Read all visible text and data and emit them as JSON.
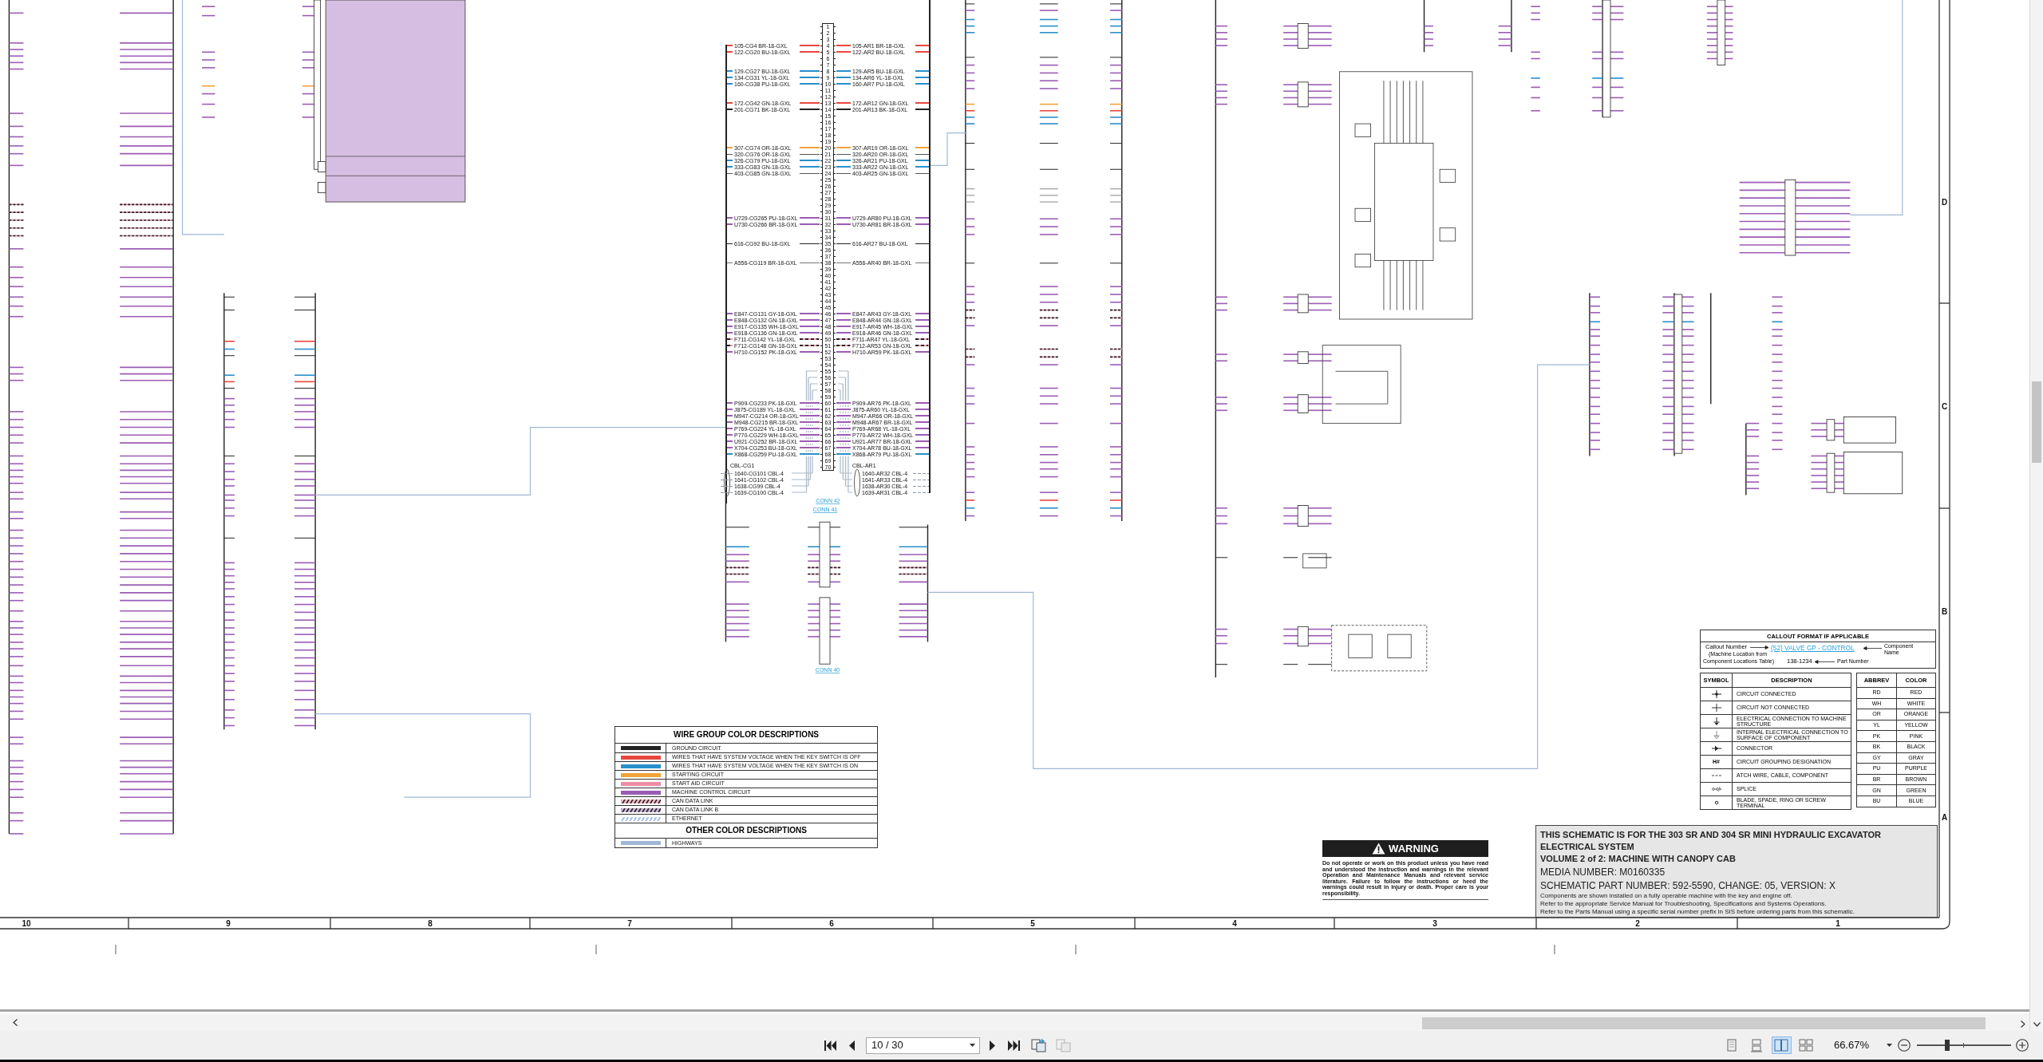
{
  "viewer": {
    "page": "10 / 30",
    "zoom": "66.67%",
    "zoom_slider": {
      "level": 0.32
    },
    "page_tools": [
      {
        "kind": "arrow",
        "disabled": false
      },
      {
        "kind": "plain",
        "disabled": true
      }
    ],
    "view_modes": [
      {
        "kind": "single",
        "selected": false
      },
      {
        "kind": "continuous",
        "selected": false
      },
      {
        "kind": "facing",
        "selected": true
      },
      {
        "kind": "split",
        "selected": false
      }
    ]
  },
  "sheet": {
    "columns": [
      "10",
      "9",
      "8",
      "7",
      "6",
      "5",
      "4",
      "3",
      "2",
      "1"
    ],
    "rows": [
      "D",
      "C",
      "B",
      "A"
    ]
  },
  "connectors": [
    {
      "link": "CONN 42",
      "pins": [
        {
          "label": "1"
        },
        {
          "label": "2"
        },
        {
          "label": "3"
        },
        {
          "label": "4",
          "left": "105-CG4 BR-18-GXL",
          "right": "105-AR1 BR-18-GXL",
          "color": "#e8473f",
          "kind": "solid"
        },
        {
          "label": "5",
          "left": "122-CG20 BU-18-GXL",
          "right": "122-AR2 BU-18-GXL",
          "color": "#e8473f",
          "kind": "solid"
        },
        {
          "label": "6"
        },
        {
          "label": "7"
        },
        {
          "label": "8",
          "left": "129-CG27 BU-18-GXL",
          "right": "129-AR5 BU-18-GXL",
          "color": "#2a8fcb",
          "kind": "solid"
        },
        {
          "label": "9",
          "left": "134-CG31 YL-18-GXL",
          "right": "134-AR6 YL-18-GXL",
          "color": "#2a8fcb",
          "kind": "solid"
        },
        {
          "label": "10",
          "left": "160-CG38 PU-18-GXL",
          "right": "160-AR7 PU-18-GXL",
          "color": "#2a8fcb",
          "kind": "solid"
        },
        {
          "label": "11"
        },
        {
          "label": "12"
        },
        {
          "label": "13",
          "left": "172-CG42 GN-18-GXL",
          "right": "172-AR12 GN-18-GXL",
          "color": "#e8473f",
          "kind": "solid"
        },
        {
          "label": "14",
          "left": "201-CG71 BK-18-GXL",
          "right": "201-AR13 BK-18-GXL",
          "color": "#222222",
          "kind": "solid"
        },
        {
          "label": "15"
        },
        {
          "label": "16"
        },
        {
          "label": "17"
        },
        {
          "label": "18"
        },
        {
          "label": "19"
        },
        {
          "label": "20",
          "left": "307-CG74 OR-18-GXL",
          "right": "307-AR19 OR-18-GXL",
          "color": "#f2a23a",
          "kind": "solid"
        },
        {
          "label": "21",
          "left": "320-CG76 OR-18-GXL",
          "right": "320-AR20 OR-18-GXL",
          "color": "#555555",
          "kind": "thin"
        },
        {
          "label": "22",
          "left": "326-CG79 PU-18-GXL",
          "right": "326-AR21 PU-18-GXL",
          "color": "#2a8fcb",
          "kind": "solid"
        },
        {
          "label": "23",
          "left": "333-CG83 GN-18-GXL",
          "right": "333-AR22 GN-18-GXL",
          "color": "#2a8fcb",
          "kind": "solid"
        },
        {
          "label": "24",
          "left": "403-CG85 GN-18-GXL",
          "right": "403-AR25 GN-18-GXL",
          "color": "#555555",
          "kind": "thin"
        },
        {
          "label": "25"
        },
        {
          "label": "26"
        },
        {
          "label": "27"
        },
        {
          "label": "28"
        },
        {
          "label": "29"
        },
        {
          "label": "30"
        },
        {
          "label": "31",
          "left": "U729-CG265 PU-18-GXL",
          "right": "U729-AR80 PU-18-GXL",
          "color": "#9b5cb4",
          "kind": "solid"
        },
        {
          "label": "32",
          "left": "U730-CG266 BR-18-GXL",
          "right": "U730-AR81 BR-18-GXL",
          "color": "#9b5cb4",
          "kind": "solid"
        },
        {
          "label": "33"
        },
        {
          "label": "34"
        },
        {
          "label": "35",
          "left": "616-CG92 BU-18-GXL",
          "right": "616-AR27 BU-18-GXL",
          "color": "#222222",
          "kind": "thin"
        },
        {
          "label": "36"
        },
        {
          "label": "37"
        },
        {
          "label": "38",
          "left": "A556-CG119 BR-18-GXL",
          "right": "A556-AR40 BR-18-GXL",
          "color": "#777777",
          "kind": "thin"
        },
        {
          "label": "39"
        },
        {
          "label": "40"
        },
        {
          "label": "41"
        },
        {
          "label": "42"
        },
        {
          "label": "43"
        },
        {
          "label": "44"
        },
        {
          "label": "45"
        },
        {
          "label": "46",
          "left": "E847-CG131 GY-18-GXL",
          "right": "E847-AR43 GY-18-GXL",
          "color": "#9b5cb4",
          "kind": "solid"
        },
        {
          "label": "47",
          "left": "E848-CG132 GN-18-GXL",
          "right": "E848-AR44 GN-18-GXL",
          "color": "#9b5cb4",
          "kind": "solid"
        },
        {
          "label": "48",
          "left": "E917-CG135 WH-18-GXL",
          "right": "E917-AR45 WH-18-GXL",
          "color": "#9b5cb4",
          "kind": "solid"
        },
        {
          "label": "49",
          "left": "E918-CG136 GN-18-GXL",
          "right": "E918-AR46 GN-18-GXL",
          "color": "#9b5cb4",
          "kind": "solid"
        },
        {
          "label": "50",
          "left": "F711-CG142 YL-18-GXL",
          "right": "F711-AR47 YL-18-GXL",
          "color": "#e89ab0",
          "kind": "striped"
        },
        {
          "label": "51",
          "left": "F712-CG148 GN-18-GXL",
          "right": "F712-AR53 GN-18-GXL",
          "color": "#e89ab0",
          "kind": "striped"
        },
        {
          "label": "52",
          "left": "H710-CG152 PK-18-GXL",
          "right": "H710-AR59 PK-18-GXL",
          "color": "#9b5cb4",
          "kind": "solid"
        },
        {
          "label": "53"
        },
        {
          "label": "54"
        },
        {
          "label": "55"
        },
        {
          "label": "56"
        },
        {
          "label": "57"
        },
        {
          "label": "58"
        },
        {
          "label": "59"
        },
        {
          "label": "60",
          "left": "P909-CG233 PK-18-GXL",
          "right": "P909-AR76 PK-18-GXL",
          "color": "#9b5cb4",
          "kind": "solid"
        },
        {
          "label": "61",
          "left": "J875-CG189 YL-18-GXL",
          "right": "J875-AR60 YL-18-GXL",
          "color": "#9b5cb4",
          "kind": "solid"
        },
        {
          "label": "62",
          "left": "M947-CG214 OR-18-GXL",
          "right": "M947-AR66 OR-18-GXL",
          "color": "#9b5cb4",
          "kind": "solid"
        },
        {
          "label": "63",
          "left": "M948-CG215 BR-18-GXL",
          "right": "M948-AR67 BR-18-GXL",
          "color": "#9b5cb4",
          "kind": "solid"
        },
        {
          "label": "64",
          "left": "P769-CG224 YL-18-GXL",
          "right": "P769-AR68 YL-18-GXL",
          "color": "#9b5cb4",
          "kind": "solid"
        },
        {
          "label": "65",
          "left": "P770-CG229 WH-18-GXL",
          "right": "P770-AR72 WH-18-GXL",
          "color": "#9b5cb4",
          "kind": "solid"
        },
        {
          "label": "66",
          "left": "U921-CG252 BR-18-GXL",
          "right": "U921-AR77 BR-18-GXL",
          "color": "#9b5cb4",
          "kind": "solid"
        },
        {
          "label": "67",
          "left": "X704-CG253 BU-18-GXL",
          "right": "X704-AR78 BU-18-GXL",
          "color": "#9b5cb4",
          "kind": "solid"
        },
        {
          "label": "68",
          "left": "X868-CG259 PU-18-GXL",
          "right": "X868-AR79 PU-18-GXL",
          "color": "#2a8fcb",
          "kind": "solid"
        },
        {
          "label": "69"
        },
        {
          "label": "70"
        }
      ],
      "cables": {
        "left_tag": "CBL-CG1",
        "right_tag": "CBL-AR1",
        "wires": [
          {
            "left": "1640-CG101 CBL-4",
            "right": "1640-AR32 CBL-4"
          },
          {
            "left": "1641-CG102 CBL-4",
            "right": "1641-AR33 CBL-4"
          },
          {
            "left": "1638-CG99 CBL-4",
            "right": "1638-AR30 CBL-4"
          },
          {
            "left": "1639-CG100 CBL-4",
            "right": "1639-AR31 CBL-4"
          }
        ]
      }
    }
  ],
  "connector_links": [
    "CONN 41",
    "CONN 40"
  ],
  "wire_legend": {
    "title": "WIRE GROUP COLOR DESCRIPTIONS",
    "items": [
      {
        "label": "GROUND CIRCUIT",
        "color": "#222222",
        "kind": "solid"
      },
      {
        "label": "WIRES THAT HAVE SYSTEM VOLTAGE WHEN THE KEY SWITCH IS OFF",
        "color": "#e8473f",
        "kind": "solid"
      },
      {
        "label": "WIRES THAT HAVE SYSTEM VOLTAGE WHEN THE KEY SWITCH IS ON",
        "color": "#2a8fcb",
        "kind": "solid"
      },
      {
        "label": "STARTING CIRCUIT",
        "color": "#f2a23a",
        "kind": "solid"
      },
      {
        "label": "START AID CIRCUIT",
        "color": "#ef8ca5",
        "kind": "solid"
      },
      {
        "label": "MACHINE CONTROL CIRCUIT",
        "color": "#9b5cb4",
        "kind": "solid"
      },
      {
        "label": "CAN DATA LINK",
        "color": "#f2b8c6",
        "kind": "striped"
      },
      {
        "label": "CAN DATA LINK B",
        "color": "#c9b3d6",
        "kind": "striped"
      },
      {
        "label": "ETHERNET",
        "color": "#a9c4e4",
        "kind": "dashed"
      }
    ],
    "other_title": "OTHER COLOR DESCRIPTIONS",
    "other_items": [
      {
        "label": "HIGHWAYS",
        "color": "#9fb8d6",
        "kind": "solid"
      }
    ]
  },
  "callout_legend": {
    "title": "CALLOUT FORMAT IF APPLICABLE",
    "callout_number": "Callout Number",
    "callout_note": [
      "(Machine Location from",
      "Component Locations Table)"
    ],
    "component": "(52) VALVE GP - CONTROL",
    "component_note": [
      "Component",
      "Name"
    ],
    "part": "138-1234",
    "part_note": "Part Number",
    "symbol_header": [
      "SYMBOL",
      "DESCRIPTION"
    ],
    "symbols": [
      {
        "kind": "junction",
        "description": "CIRCUIT CONNECTED"
      },
      {
        "kind": "crossing",
        "description": "CIRCUIT NOT CONNECTED"
      },
      {
        "kind": "ground",
        "description": "ELECTRICAL CONNECTION TO MACHINE STRUCTURE"
      },
      {
        "kind": "internal_ground",
        "description": "INTERNAL ELECTRICAL CONNECTION TO SURFACE OF COMPONENT"
      },
      {
        "kind": "connector",
        "description": "CONNECTOR"
      },
      {
        "kind": "text",
        "symbol": "H#",
        "description": "CIRCUIT GROUPING DESIGNATION"
      },
      {
        "kind": "dashed",
        "description": "ATCH WIRE, CABLE, COMPONENT"
      },
      {
        "kind": "splice",
        "description": "SPLICE"
      },
      {
        "kind": "terminal",
        "description": "BLADE, SPADE, RING OR SCREW TERMINAL"
      }
    ],
    "color_header": [
      "ABBREV",
      "COLOR"
    ],
    "colors": [
      {
        "abbrev": "RD",
        "name": "RED"
      },
      {
        "abbrev": "WH",
        "name": "WHITE"
      },
      {
        "abbrev": "OR",
        "name": "ORANGE"
      },
      {
        "abbrev": "YL",
        "name": "YELLOW"
      },
      {
        "abbrev": "PK",
        "name": "PINK"
      },
      {
        "abbrev": "BK",
        "name": "BLACK"
      },
      {
        "abbrev": "GY",
        "name": "GRAY"
      },
      {
        "abbrev": "PU",
        "name": "PURPLE"
      },
      {
        "abbrev": "BR",
        "name": "BROWN"
      },
      {
        "abbrev": "GN",
        "name": "GREEN"
      },
      {
        "abbrev": "BU",
        "name": "BLUE"
      }
    ]
  },
  "warning": {
    "title": "WARNING",
    "text": "Do not operate or work on this product unless you have read and understood the instruction and warnings in the relevant Operation and Maintenance Manuals and relevant service literature. Failure to follow the instructions or heed the warnings could result in injury or death. Proper care is your responsibility."
  },
  "title_block": {
    "heading": "THIS SCHEMATIC IS FOR THE 303 SR AND 304 SR MINI HYDRAULIC EXCAVATOR ELECTRICAL SYSTEM",
    "volume": "VOLUME 2 of 2: MACHINE WITH CANOPY CAB",
    "media": "MEDIA NUMBER: M0160335",
    "part": "SCHEMATIC PART NUMBER: 592-5590, CHANGE: 05, VERSION: X",
    "notes": [
      "Components are shown installed on a fully operable machine with the key and engine off.",
      "Refer to the appropriate Service Manual for Troubleshooting, Specifications and Systems Operations.",
      "Refer to the Parts Manual using a specific serial number prefix in SIS before ordering parts from this schematic."
    ]
  }
}
